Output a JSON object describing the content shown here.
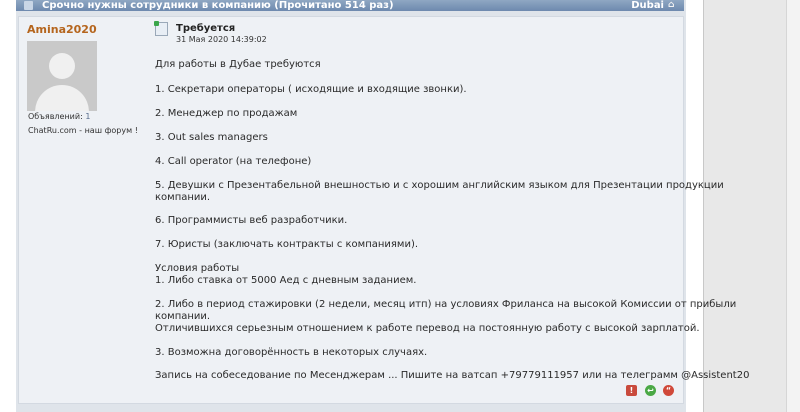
{
  "topic_bar": {
    "title": "Срочно нужны сотрудники в компанию  (Прочитано 514 раз)",
    "location": "Dubai"
  },
  "author": {
    "name": "Amina2020",
    "ads_label": "Объявлений:",
    "ads_count": "1",
    "tagline": "ChatRu.com - наш форум !"
  },
  "post": {
    "title": "Требуется",
    "date": "31 Мая 2020 14:39:02",
    "lines": [
      "Для работы в Дубае требуются",
      "1. Секретари операторы ( исходящие и входящие звонки).",
      "2. Менеджер по продажам",
      "3. Out sales managers",
      "4. Call operator (на телефоне)",
      "5. Девушки с Презентабельной внешностью и с хорошим английским языком для Презентации продукции",
      "компании.",
      "6. Программисты веб разработчики.",
      "7. Юристы (заключать контракты с компаниями).",
      "Условия работы",
      "1. Либо ставка от 5000 Аед с дневным заданием.",
      "2. Либо в период стажировки (2 недели, месяц итп) на условиях Фриланса на высокой Комиссии от прибыли",
      "компании.",
      "Отличившихся серьезным отношением к работе перевод на постоянную работу с высокой зарплатой.",
      "3. Возможна договорённость в некоторых случаях.",
      "Запись на собеседование по Месенджерам ... Пишите на ватсап    +79779111957 или на телеграмм @Assistent20"
    ]
  },
  "colors": {
    "title_bar": "#7893b5",
    "author_name": "#b5651d",
    "post_background": "#eef1f5",
    "frame_background": "#dfe4ea"
  }
}
